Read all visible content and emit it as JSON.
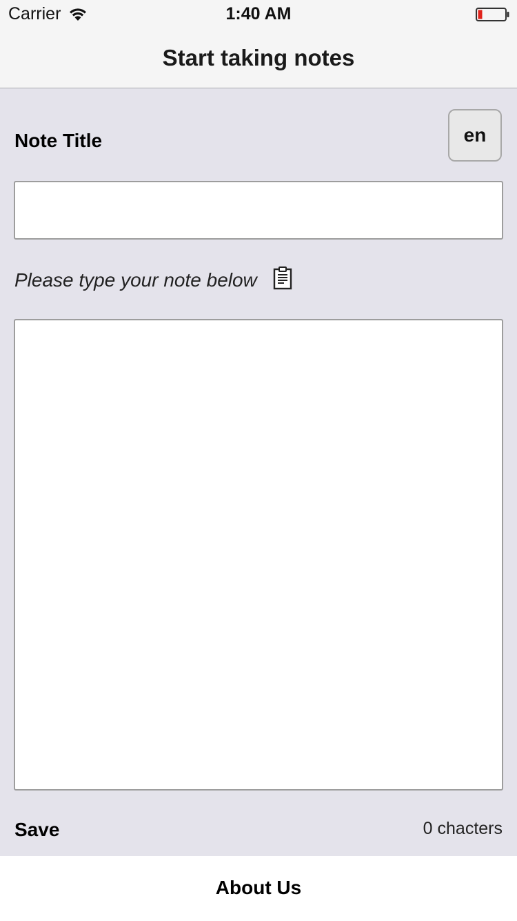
{
  "status_bar": {
    "carrier": "Carrier",
    "time": "1:40 AM",
    "wifi_icon": "wifi-icon",
    "battery_icon": "battery-low-icon",
    "battery_color": "#e0231c"
  },
  "nav": {
    "title": "Start taking notes"
  },
  "form": {
    "title_label": "Note Title",
    "language_button": "en",
    "title_value": "",
    "hint": "Please type your note below",
    "hint_icon": "clipboard-icon",
    "note_value": "",
    "save_label": "Save",
    "char_count": "0 chacters"
  },
  "tab_bar": {
    "about_label": "About Us"
  },
  "colors": {
    "background": "#e4e3eb",
    "bar_background": "#f5f5f5"
  }
}
